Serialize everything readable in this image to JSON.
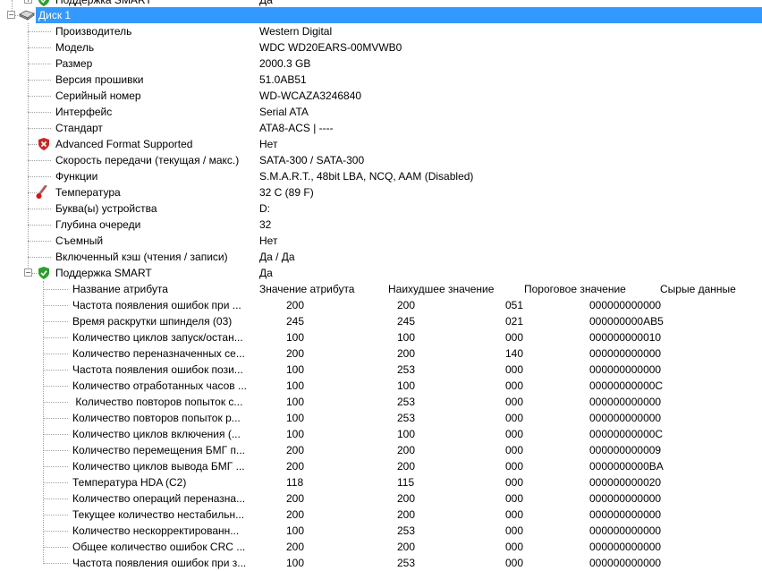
{
  "top_partial_row": {
    "label": "Поддержка SMART",
    "value": "Да"
  },
  "disk": {
    "label": "Диск 1"
  },
  "properties": [
    {
      "label": "Производитель",
      "value": "Western Digital",
      "icon": ""
    },
    {
      "label": "Модель",
      "value": "WDC WD20EARS-00MVWB0",
      "icon": ""
    },
    {
      "label": "Размер",
      "value": "2000.3 GB",
      "icon": ""
    },
    {
      "label": "Версия прошивки",
      "value": "51.0AB51",
      "icon": ""
    },
    {
      "label": "Серийный номер",
      "value": "WD-WCAZA3246840",
      "icon": ""
    },
    {
      "label": "Интерфейс",
      "value": "Serial ATA",
      "icon": ""
    },
    {
      "label": "Стандарт",
      "value": "ATA8-ACS | ----",
      "icon": ""
    },
    {
      "label": "Advanced Format Supported",
      "value": "Нет",
      "icon": "shield-red-x-icon"
    },
    {
      "label": "Скорость передачи (текущая / макс.)",
      "value": "SATA-300 / SATA-300",
      "icon": ""
    },
    {
      "label": "Функции",
      "value": "S.M.A.R.T., 48bit LBA, NCQ, AAM (Disabled)",
      "icon": ""
    },
    {
      "label": "Температура",
      "value": "32 C (89 F)",
      "icon": "thermometer-icon"
    },
    {
      "label": "Буква(ы) устройства",
      "value": "D:",
      "icon": ""
    },
    {
      "label": "Глубина очереди",
      "value": "32",
      "icon": ""
    },
    {
      "label": "Съемный",
      "value": "Нет",
      "icon": ""
    },
    {
      "label": "Включенный кэш (чтения / записи)",
      "value": "Да / Да",
      "icon": ""
    },
    {
      "label": "Поддержка SMART",
      "value": "Да",
      "icon": "shield-green-check-icon"
    }
  ],
  "smart_header": {
    "name": "Название атрибута",
    "value": "Значение атрибута",
    "worst": "Наихудшее значение",
    "threshold": "Пороговое значение",
    "raw": "Сырые данные"
  },
  "smart_rows": [
    {
      "name": "Частота появления ошибок при ...",
      "value": "200",
      "worst": "200",
      "threshold": "051",
      "raw": "000000000000"
    },
    {
      "name": "Время раскрутки шпинделя (03)",
      "value": "245",
      "worst": "245",
      "threshold": "021",
      "raw": "000000000AB5"
    },
    {
      "name": "Количество циклов запуск/остан...",
      "value": "100",
      "worst": "100",
      "threshold": "000",
      "raw": "000000000010"
    },
    {
      "name": "Количество переназначенных се...",
      "value": "200",
      "worst": "200",
      "threshold": "140",
      "raw": "000000000000"
    },
    {
      "name": "Частота появления ошибок пози...",
      "value": "100",
      "worst": "253",
      "threshold": "000",
      "raw": "000000000000"
    },
    {
      "name": "Количество отработанных часов ...",
      "value": "100",
      "worst": "100",
      "threshold": "000",
      "raw": "00000000000C"
    },
    {
      "name": " Количество повторов попыток с...",
      "value": "100",
      "worst": "253",
      "threshold": "000",
      "raw": "000000000000"
    },
    {
      "name": "Количество повторов попыток р...",
      "value": "100",
      "worst": "253",
      "threshold": "000",
      "raw": "000000000000"
    },
    {
      "name": "Количество циклов включения (...",
      "value": "100",
      "worst": "100",
      "threshold": "000",
      "raw": "00000000000C"
    },
    {
      "name": "Количество перемещения БМГ п...",
      "value": "200",
      "worst": "200",
      "threshold": "000",
      "raw": "000000000009"
    },
    {
      "name": "Количество циклов вывода БМГ ...",
      "value": "200",
      "worst": "200",
      "threshold": "000",
      "raw": "0000000000BA"
    },
    {
      "name": "Температура HDA (C2)",
      "value": "118",
      "worst": "115",
      "threshold": "000",
      "raw": "000000000020"
    },
    {
      "name": "Количество операций переназна...",
      "value": "200",
      "worst": "200",
      "threshold": "000",
      "raw": "000000000000"
    },
    {
      "name": "Текущее количество нестабильн...",
      "value": "200",
      "worst": "200",
      "threshold": "000",
      "raw": "000000000000"
    },
    {
      "name": "Количество нескорректированн...",
      "value": "100",
      "worst": "253",
      "threshold": "000",
      "raw": "000000000000"
    },
    {
      "name": "Общее количество ошибок CRC ...",
      "value": "200",
      "worst": "200",
      "threshold": "000",
      "raw": "000000000000"
    },
    {
      "name": "Частота появления ошибок при з...",
      "value": "100",
      "worst": "253",
      "threshold": "000",
      "raw": "000000000000"
    }
  ]
}
